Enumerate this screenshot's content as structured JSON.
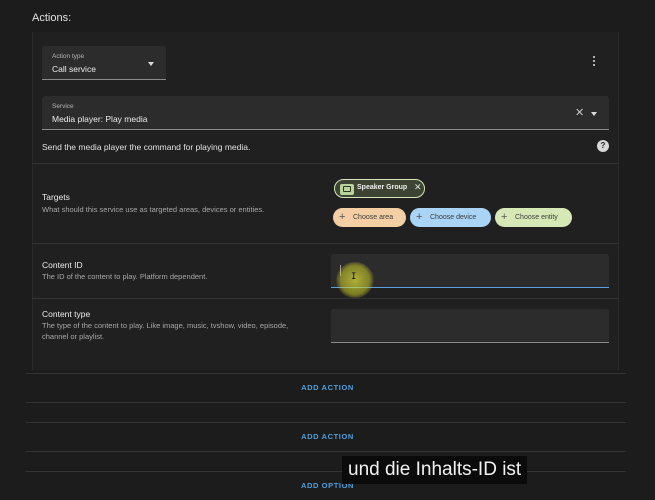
{
  "section": {
    "heading": "Actions:"
  },
  "action": {
    "type_label": "Action type",
    "type_value": "Call service",
    "service_label": "Service",
    "service_value": "Media player: Play media",
    "description": "Send the media player the command for playing media."
  },
  "targets": {
    "title": "Targets",
    "subtitle": "What should this service use as targeted areas, devices or entities.",
    "chip_label": "Speaker Group",
    "choose_area": "Choose area",
    "choose_device": "Choose device",
    "choose_entity": "Choose entity"
  },
  "content_id": {
    "title": "Content ID",
    "subtitle": "The ID of the content to play. Platform dependent.",
    "value": ""
  },
  "content_type": {
    "title": "Content type",
    "subtitle": "The type of the content to play. Like image, music, tvshow, video, episode, channel or playlist.",
    "value": ""
  },
  "buttons": {
    "add_action_1": "ADD ACTION",
    "add_action_2": "ADD ACTION",
    "add_option": "ADD OPTION"
  },
  "caption": "und die Inhalts-ID ist",
  "colors": {
    "accent": "#4f9fdc",
    "area_pill": "#f4cfa4",
    "device_pill": "#a9d4f5",
    "entity_pill": "#d5e8b6"
  },
  "icons": [
    "chevron-down-icon",
    "more-vert-icon",
    "close-icon",
    "help-icon",
    "cast-icon",
    "plus-icon"
  ]
}
